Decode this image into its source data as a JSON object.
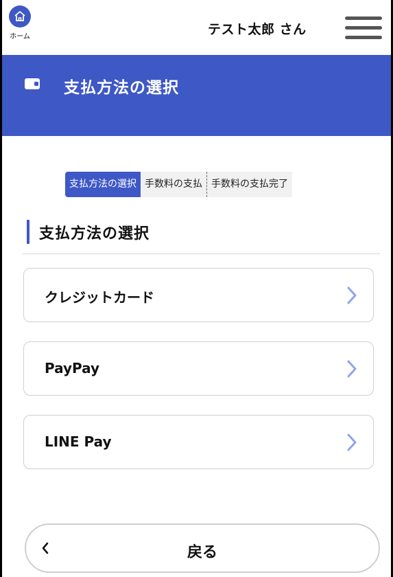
{
  "header": {
    "home_label": "ホーム",
    "user_name": "テスト太郎 さん"
  },
  "banner": {
    "title": "支払方法の選択"
  },
  "steps": [
    {
      "label": "支払方法の選択",
      "active": true
    },
    {
      "label": "手数料の支払",
      "active": false
    },
    {
      "label": "手数料の支払完了",
      "active": false
    }
  ],
  "section": {
    "title": "支払方法の選択"
  },
  "options": [
    {
      "label": "クレジットカード"
    },
    {
      "label": "PayPay"
    },
    {
      "label": "LINE Pay"
    }
  ],
  "back": {
    "label": "戻る"
  },
  "colors": {
    "brand": "#3e58c6",
    "chevron": "#8fa6e6"
  }
}
